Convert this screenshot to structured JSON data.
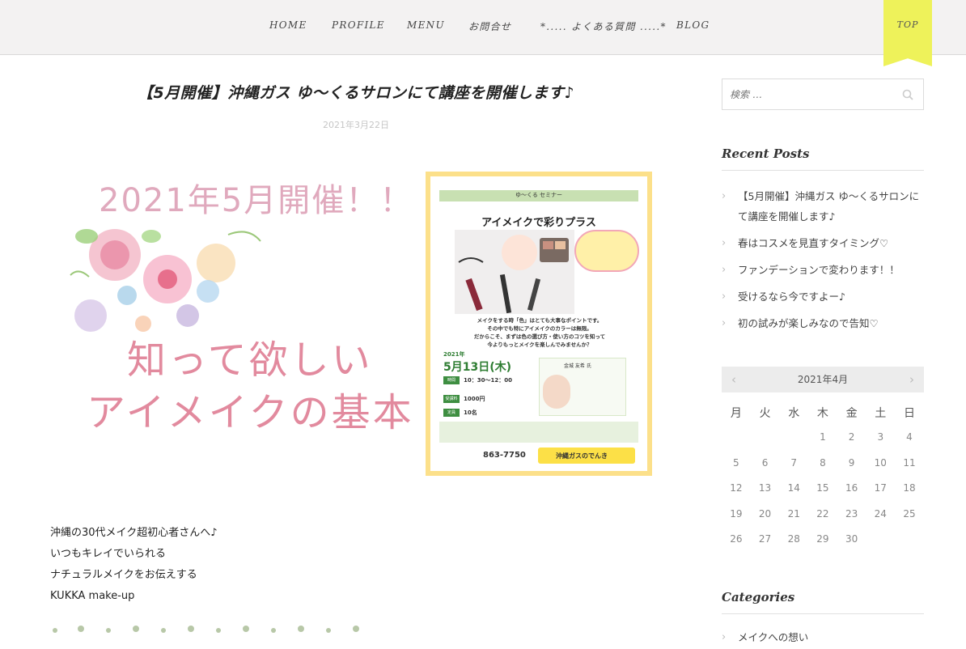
{
  "nav": {
    "items": [
      "HOME",
      "PROFILE",
      "MENU",
      "お問合せ",
      "*..... よくある質問 .....*",
      "BLOG"
    ],
    "top_label": "TOP"
  },
  "post": {
    "title": "【5月開催】沖縄ガス ゆ～くるサロンにて講座を開催します♪",
    "date": "2021年3月22日",
    "hero_heading": "2021年5月開催！！",
    "hero_title_line1": "知って欲しい",
    "hero_title_line2": "アイメイクの基本",
    "flyer": {
      "band": "ゆ～くる セミナー",
      "title": "アイメイクで彩りプラス",
      "body": [
        "メイクをする時「色」はとても大事なポイントです。",
        "その中でも特にアイメイクのカラーは無限。",
        "だからこそ、まずは色の選び方・使い方のコツを知って",
        "今よりもっとメイクを楽しんでみませんか？"
      ],
      "year": "2021年",
      "date": "5月13日(木)",
      "rows": [
        {
          "key": "時間",
          "value": "10：30～12：00"
        },
        {
          "key": "受講料",
          "value": "1000円"
        },
        {
          "key": "定員",
          "value": "10名"
        }
      ],
      "lecturer": "金城 友希 氏",
      "phone": "863-7750",
      "gas": "沖縄ガスのでんき"
    },
    "body_lines": [
      "沖縄の30代メイク超初心者さんへ♪",
      "いつもキレイでいられる",
      "ナチュラルメイクをお伝えする",
      "KUKKA make-up"
    ]
  },
  "sidebar": {
    "search_placeholder": "検索 …",
    "recent_title": "Recent Posts",
    "recent_posts": [
      "【5月開催】沖縄ガス ゆ～くるサロンにて講座を開催します♪",
      "春はコスメを見直すタイミング♡",
      "ファンデーションで変わります！！",
      "受けるなら今ですよー♪",
      "初の試みが楽しみなので告知♡"
    ],
    "calendar": {
      "month": "2021年4月",
      "prev": "‹",
      "next": "›",
      "weekdays": [
        "月",
        "火",
        "水",
        "木",
        "金",
        "土",
        "日"
      ],
      "days": [
        "",
        "",
        "",
        "1",
        "2",
        "3",
        "4",
        "5",
        "6",
        "7",
        "8",
        "9",
        "10",
        "11",
        "12",
        "13",
        "14",
        "15",
        "16",
        "17",
        "18",
        "19",
        "20",
        "21",
        "22",
        "23",
        "24",
        "25",
        "26",
        "27",
        "28",
        "29",
        "30",
        "",
        ""
      ]
    },
    "categories_title": "Categories",
    "categories": [
      "メイクへの想い"
    ]
  }
}
